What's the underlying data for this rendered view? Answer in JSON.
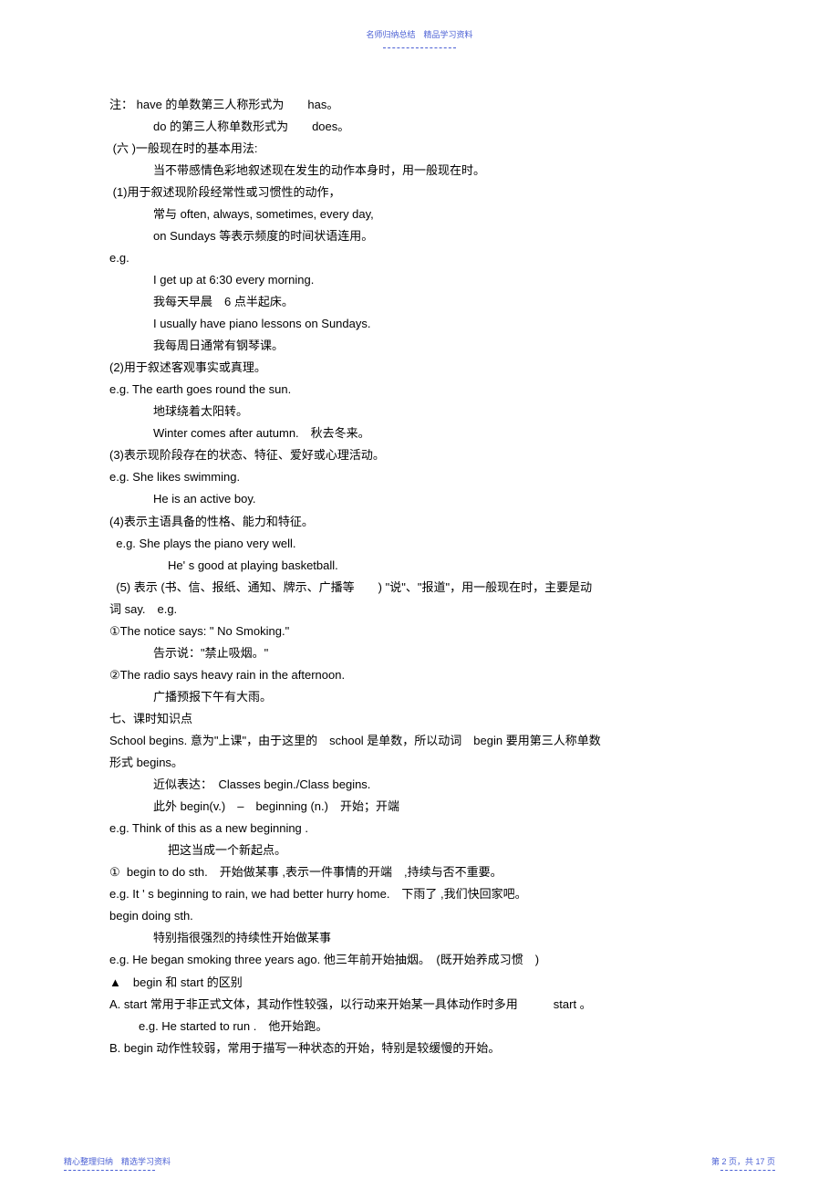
{
  "header": {
    "text": "名师归纳总结　精品学习资料"
  },
  "content": {
    "lines": [
      {
        "text": "注： have 的单数第三人称形式为　　has。",
        "indent": 0
      },
      {
        "text": "do 的第三人称单数形式为　　does。",
        "indent": 2
      },
      {
        "text": " (六 )一般现在时的基本用法:",
        "indent": 0
      },
      {
        "text": "当不带感情色彩地叙述现在发生的动作本身时，用一般现在时。",
        "indent": 2
      },
      {
        "text": " (1)用于叙述现阶段经常性或习惯性的动作，",
        "indent": 0
      },
      {
        "text": "常与 often, always, sometimes, every day,",
        "indent": 2
      },
      {
        "text": "on Sundays 等表示频度的时间状语连用。",
        "indent": 2
      },
      {
        "text": "e.g.",
        "indent": 0
      },
      {
        "text": "I get up at 6:30 every morning.",
        "indent": 2
      },
      {
        "text": "我每天早晨　6 点半起床。",
        "indent": 2
      },
      {
        "text": "I usually have piano lessons on Sundays.",
        "indent": 2
      },
      {
        "text": "我每周日通常有钢琴课。",
        "indent": 2
      },
      {
        "text": "(2)用于叙述客观事实或真理。",
        "indent": 0
      },
      {
        "text": "e.g. The earth goes round the sun.",
        "indent": 0
      },
      {
        "text": "地球绕着太阳转。",
        "indent": 2
      },
      {
        "text": "Winter comes after autumn.　秋去冬来。",
        "indent": 2
      },
      {
        "text": "(3)表示现阶段存在的状态、特征、爱好或心理活动。",
        "indent": 0
      },
      {
        "text": "e.g. She likes swimming.",
        "indent": 0
      },
      {
        "text": "He is an active boy.",
        "indent": 2
      },
      {
        "text": "(4)表示主语具备的性格、能力和特征。",
        "indent": 0
      },
      {
        "text": "  e.g. She plays the piano very well.",
        "indent": 0
      },
      {
        "text": "He' s good at playing basketball.",
        "indent": 3
      },
      {
        "text": "  (5) 表示 (书、信、报纸、通知、牌示、广播等　　) \"说\"、\"报道\"，用一般现在时，主要是动",
        "indent": 0
      },
      {
        "text": "词 say.　e.g.",
        "indent": 0
      },
      {
        "text": "①The notice says: \" No Smoking.\"",
        "indent": 0
      },
      {
        "text": "告示说：\"禁止吸烟。\"",
        "indent": 2
      },
      {
        "text": "②The radio says heavy rain in the afternoon.",
        "indent": 0
      },
      {
        "text": "广播预报下午有大雨。",
        "indent": 2
      },
      {
        "text": "七、课时知识点",
        "indent": 0
      },
      {
        "text": "School begins. 意为\"上课\"，由于这里的　school 是单数，所以动词　begin 要用第三人称单数",
        "indent": 0
      },
      {
        "text": "形式 begins。",
        "indent": 0
      },
      {
        "text": "近似表达：　Classes begin./Class begins.",
        "indent": 2
      },
      {
        "text": "此外 begin(v.)　–　beginning (n.)　开始；开端",
        "indent": 2
      },
      {
        "text": "e.g. Think of this as a new beginning .",
        "indent": 0
      },
      {
        "text": "把这当成一个新起点。",
        "indent": 3
      },
      {
        "text": "①  begin to do sth.　开始做某事 ,表示一件事情的开端　,持续与否不重要。",
        "indent": 0
      },
      {
        "text": "e.g. It ' s beginning to rain, we had better hurry home.　下雨了 ,我们快回家吧。",
        "indent": 0
      },
      {
        "text": "begin doing sth.",
        "indent": 0
      },
      {
        "text": "特别指很强烈的持续性开始做某事",
        "indent": 2
      },
      {
        "text": "e.g. He began smoking three years ago. 他三年前开始抽烟。　(既开始养成习惯　)",
        "indent": 0
      },
      {
        "text": "▲　begin 和 start 的区别",
        "indent": 0
      },
      {
        "text": "A. start 常用于非正式文体，其动作性较强，以行动来开始某一具体动作时多用　　　start 。",
        "indent": 0
      },
      {
        "text": "e.g. He started to run .　他开始跑。",
        "indent": 1
      },
      {
        "text": "B. begin 动作性较弱，常用于描写一种状态的开始，特别是较缓慢的开始。",
        "indent": 0
      }
    ]
  },
  "footer": {
    "left": "精心整理归纳　精选学习资料",
    "right": "第 2 页，共 17 页"
  }
}
